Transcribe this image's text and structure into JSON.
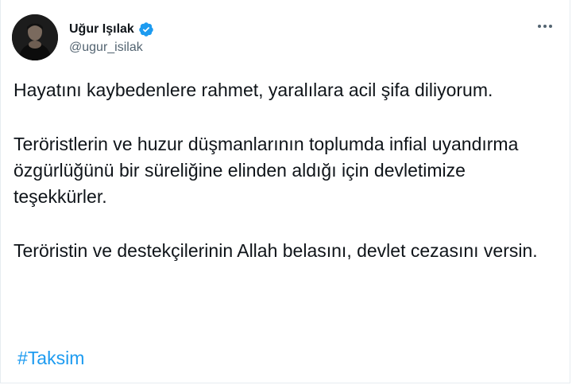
{
  "author": {
    "display_name": "Uğur Işılak",
    "handle": "@ugur_isilak",
    "avatar_icon": "profile-photo",
    "verified_icon": "verified-badge-icon",
    "verified_color": "#1d9bf0"
  },
  "menu": {
    "icon": "more-options-icon"
  },
  "tweet": {
    "paragraphs": [
      "Hayatını kaybedenlere rahmet, yaralılara acil şifa diliyorum.",
      "Teröristlerin ve huzur düşmanlarının toplumda infial uyandırma özgürlüğünü bir süreliğine elinden aldığı için devletimize teşekkürler.",
      "Teröristin ve destekçilerinin Allah belasını, devlet cezasını versin."
    ],
    "hashtag": "#Taksim",
    "hashtag_color": "#1d9bf0"
  }
}
